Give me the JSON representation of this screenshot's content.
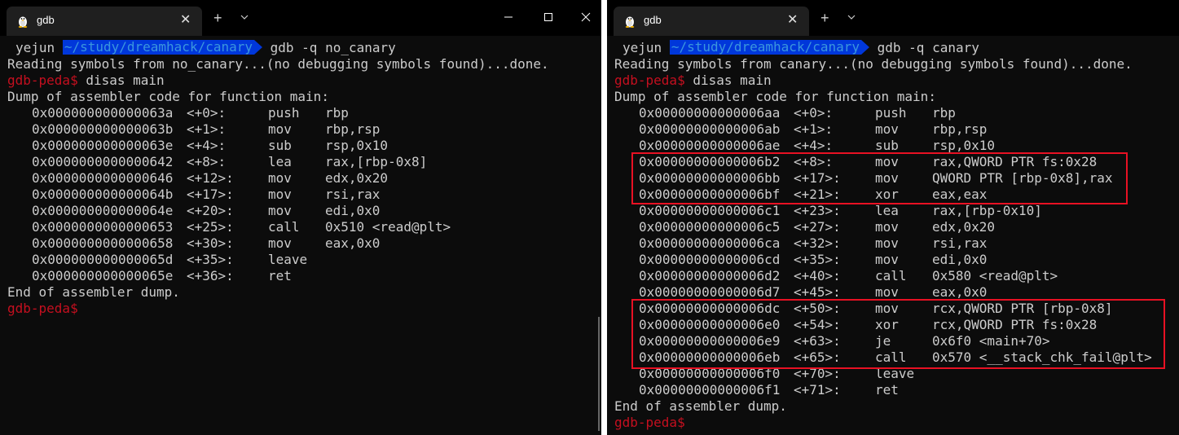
{
  "left": {
    "tab_title": "gdb",
    "tab_close": "✕",
    "new_tab": "+",
    "prompt_user": "yejun",
    "prompt_path": "~/study/dreamhack/canary",
    "command": "gdb -q no_canary",
    "reading": "Reading symbols from no_canary...(no debugging symbols found)...done.",
    "gdb_prompt": "gdb-peda$",
    "gdb_command": " disas main",
    "dump_header": "Dump of assembler code for function main:",
    "asm": [
      {
        "addr": "0x000000000000063a",
        "off": "<+0>:",
        "mn": "push",
        "op": "rbp"
      },
      {
        "addr": "0x000000000000063b",
        "off": "<+1>:",
        "mn": "mov",
        "op": "rbp,rsp"
      },
      {
        "addr": "0x000000000000063e",
        "off": "<+4>:",
        "mn": "sub",
        "op": "rsp,0x10"
      },
      {
        "addr": "0x0000000000000642",
        "off": "<+8>:",
        "mn": "lea",
        "op": "rax,[rbp-0x8]"
      },
      {
        "addr": "0x0000000000000646",
        "off": "<+12>:",
        "mn": "mov",
        "op": "edx,0x20"
      },
      {
        "addr": "0x000000000000064b",
        "off": "<+17>:",
        "mn": "mov",
        "op": "rsi,rax"
      },
      {
        "addr": "0x000000000000064e",
        "off": "<+20>:",
        "mn": "mov",
        "op": "edi,0x0"
      },
      {
        "addr": "0x0000000000000653",
        "off": "<+25>:",
        "mn": "call",
        "op": "0x510 <read@plt>"
      },
      {
        "addr": "0x0000000000000658",
        "off": "<+30>:",
        "mn": "mov",
        "op": "eax,0x0"
      },
      {
        "addr": "0x000000000000065d",
        "off": "<+35>:",
        "mn": "leave",
        "op": ""
      },
      {
        "addr": "0x000000000000065e",
        "off": "<+36>:",
        "mn": "ret",
        "op": ""
      }
    ],
    "dump_footer": "End of assembler dump.",
    "final_prompt": "gdb-peda$"
  },
  "right": {
    "tab_title": "gdb",
    "tab_close": "✕",
    "new_tab": "+",
    "prompt_user": "yejun",
    "prompt_path": "~/study/dreamhack/canary",
    "command": "gdb -q canary",
    "reading": "Reading symbols from canary...(no debugging symbols found)...done.",
    "gdb_prompt": "gdb-peda$",
    "gdb_command": " disas main",
    "dump_header": "Dump of assembler code for function main:",
    "asm": [
      {
        "addr": "0x00000000000006aa",
        "off": "<+0>:",
        "mn": "push",
        "op": "rbp"
      },
      {
        "addr": "0x00000000000006ab",
        "off": "<+1>:",
        "mn": "mov",
        "op": "rbp,rsp"
      },
      {
        "addr": "0x00000000000006ae",
        "off": "<+4>:",
        "mn": "sub",
        "op": "rsp,0x10"
      },
      {
        "addr": "0x00000000000006b2",
        "off": "<+8>:",
        "mn": "mov",
        "op": "rax,QWORD PTR fs:0x28"
      },
      {
        "addr": "0x00000000000006bb",
        "off": "<+17>:",
        "mn": "mov",
        "op": "QWORD PTR [rbp-0x8],rax"
      },
      {
        "addr": "0x00000000000006bf",
        "off": "<+21>:",
        "mn": "xor",
        "op": "eax,eax"
      },
      {
        "addr": "0x00000000000006c1",
        "off": "<+23>:",
        "mn": "lea",
        "op": "rax,[rbp-0x10]"
      },
      {
        "addr": "0x00000000000006c5",
        "off": "<+27>:",
        "mn": "mov",
        "op": "edx,0x20"
      },
      {
        "addr": "0x00000000000006ca",
        "off": "<+32>:",
        "mn": "mov",
        "op": "rsi,rax"
      },
      {
        "addr": "0x00000000000006cd",
        "off": "<+35>:",
        "mn": "mov",
        "op": "edi,0x0"
      },
      {
        "addr": "0x00000000000006d2",
        "off": "<+40>:",
        "mn": "call",
        "op": "0x580 <read@plt>"
      },
      {
        "addr": "0x00000000000006d7",
        "off": "<+45>:",
        "mn": "mov",
        "op": "eax,0x0"
      },
      {
        "addr": "0x00000000000006dc",
        "off": "<+50>:",
        "mn": "mov",
        "op": "rcx,QWORD PTR [rbp-0x8]"
      },
      {
        "addr": "0x00000000000006e0",
        "off": "<+54>:",
        "mn": "xor",
        "op": "rcx,QWORD PTR fs:0x28"
      },
      {
        "addr": "0x00000000000006e9",
        "off": "<+63>:",
        "mn": "je",
        "op": "0x6f0 <main+70>"
      },
      {
        "addr": "0x00000000000006eb",
        "off": "<+65>:",
        "mn": "call",
        "op": "0x570 <__stack_chk_fail@plt>"
      },
      {
        "addr": "0x00000000000006f0",
        "off": "<+70>:",
        "mn": "leave",
        "op": ""
      },
      {
        "addr": "0x00000000000006f1",
        "off": "<+71>:",
        "mn": "ret",
        "op": ""
      }
    ],
    "dump_footer": "End of assembler dump.",
    "final_prompt": "gdb-peda$"
  },
  "colors": {
    "background": "#0c0c0c",
    "titlebar": "#000000",
    "tab": "#1f1f1f",
    "foreground": "#cccccc",
    "gdb_prompt": "#c50f1f",
    "path_segment_bg": "#0037da",
    "path_segment_fg": "#3a96dd",
    "highlight_box": "#e81123"
  }
}
